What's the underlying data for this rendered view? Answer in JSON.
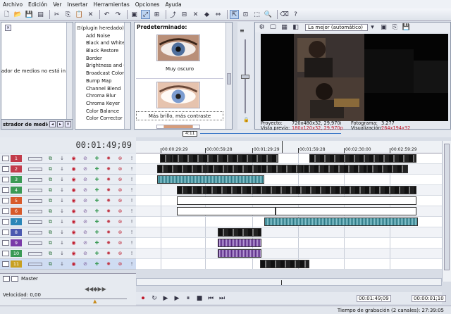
{
  "menu": [
    "Archivo",
    "Edición",
    "Ver",
    "Insertar",
    "Herramientas",
    "Opciones",
    "Ayuda"
  ],
  "project_media": {
    "message": "istrador de medios no está in",
    "tab_label": "strador de medios"
  },
  "fx_list": [
    "(plugin heredado)",
    "Add Noise",
    "Black and White",
    "Black Restore",
    "Border",
    "Brightness and Co",
    "Broadcast Colors",
    "Bump Map",
    "Channel Blend",
    "Chroma Blur",
    "Chroma Keyer",
    "Color Balance",
    "Color Corrector"
  ],
  "presets": {
    "title": "Predeterminado:",
    "items": [
      "Muy oscuro",
      "Más brillo, más contraste"
    ]
  },
  "preview": {
    "quality": "La mejor (automático)",
    "project_label": "Proyecto:",
    "project_value": "720x480x32, 29,970i",
    "frame_label": "Fotograma:",
    "frame_value": "3.277",
    "preview_label": "Vista previa:",
    "preview_value": "180x120x32, 29,970p",
    "display_label": "Visualización:",
    "display_value": "264x194x32"
  },
  "timeline": {
    "timecode": "00:01:49;09",
    "marker": "4:11",
    "ruler": [
      "00:00:29:29",
      "00:00:59:28",
      "00:01:29:29",
      "00:01:59:28",
      "00:02:30:00",
      "00:02:59:29"
    ],
    "tracks": [
      {
        "num": "1",
        "color": "#c23b4a"
      },
      {
        "num": "2",
        "color": "#c23b4a"
      },
      {
        "num": "3",
        "color": "#3a9a55"
      },
      {
        "num": "4",
        "color": "#3a9a55"
      },
      {
        "num": "5",
        "color": "#d85a2a"
      },
      {
        "num": "6",
        "color": "#d85a2a"
      },
      {
        "num": "7",
        "color": "#2a86b8"
      },
      {
        "num": "8",
        "color": "#4c5ab0"
      },
      {
        "num": "9",
        "color": "#7a3aa8"
      },
      {
        "num": "10",
        "color": "#3a9a55"
      },
      {
        "num": "11",
        "color": "#c8a020"
      }
    ],
    "master": "Master",
    "speed": "Velocidad: 0,00",
    "tc_left": "00:01:49;09",
    "tc_right": "00:00:01;10"
  },
  "status": "Tiempo de grabación (2 canales): 27:39:05"
}
